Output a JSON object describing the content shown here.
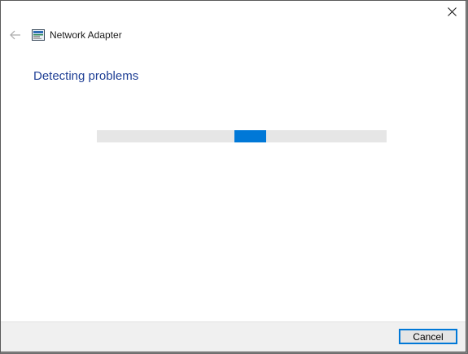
{
  "window": {
    "title": "Network Adapter",
    "app_icon": "network-adapter-icon"
  },
  "nav": {
    "back_icon": "back-arrow-icon",
    "close_icon": "close-icon"
  },
  "main": {
    "heading": "Detecting problems",
    "progress": {
      "style": "indeterminate",
      "chunk_position_fraction": 0.53
    }
  },
  "footer": {
    "cancel_label": "Cancel"
  },
  "colors": {
    "accent": "#0078d7",
    "heading": "#1f3f95",
    "track": "#e6e6e6",
    "footer_bg": "#f0f0f0"
  }
}
